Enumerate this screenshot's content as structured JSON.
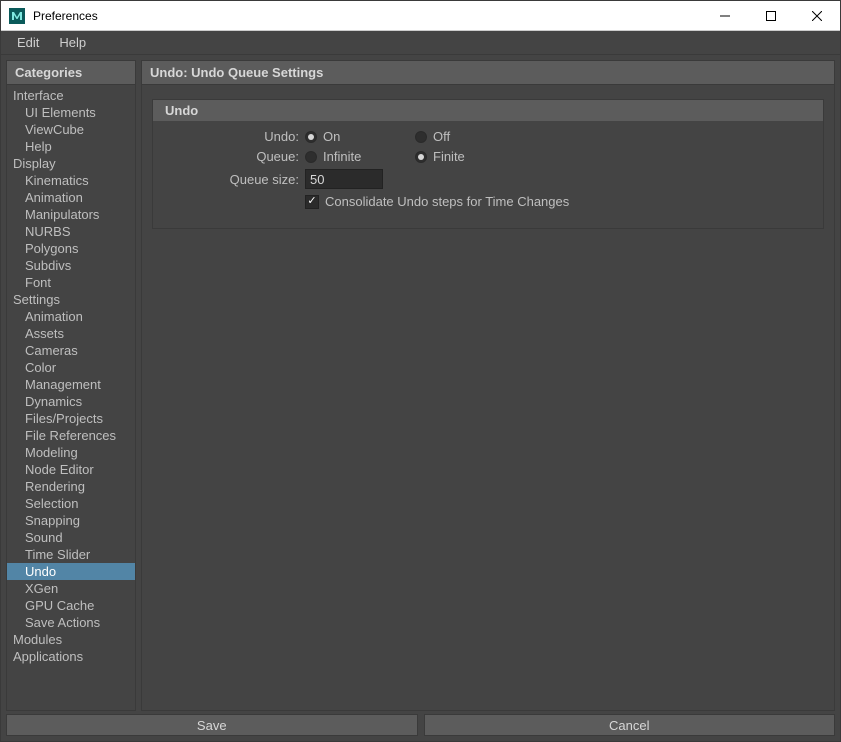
{
  "window": {
    "title": "Preferences"
  },
  "menubar": {
    "edit": "Edit",
    "help": "Help"
  },
  "sidebar": {
    "header": "Categories",
    "tree": [
      {
        "label": "Interface",
        "type": "group"
      },
      {
        "label": "UI Elements",
        "type": "item"
      },
      {
        "label": "ViewCube",
        "type": "item"
      },
      {
        "label": "Help",
        "type": "item"
      },
      {
        "label": "Display",
        "type": "group"
      },
      {
        "label": "Kinematics",
        "type": "item"
      },
      {
        "label": "Animation",
        "type": "item"
      },
      {
        "label": "Manipulators",
        "type": "item"
      },
      {
        "label": "NURBS",
        "type": "item"
      },
      {
        "label": "Polygons",
        "type": "item"
      },
      {
        "label": "Subdivs",
        "type": "item"
      },
      {
        "label": "Font",
        "type": "item"
      },
      {
        "label": "Settings",
        "type": "group"
      },
      {
        "label": "Animation",
        "type": "item"
      },
      {
        "label": "Assets",
        "type": "item"
      },
      {
        "label": "Cameras",
        "type": "item"
      },
      {
        "label": "Color Management",
        "type": "item"
      },
      {
        "label": "Dynamics",
        "type": "item"
      },
      {
        "label": "Files/Projects",
        "type": "item"
      },
      {
        "label": "File References",
        "type": "item"
      },
      {
        "label": "Modeling",
        "type": "item"
      },
      {
        "label": "Node Editor",
        "type": "item"
      },
      {
        "label": "Rendering",
        "type": "item"
      },
      {
        "label": "Selection",
        "type": "item"
      },
      {
        "label": "Snapping",
        "type": "item"
      },
      {
        "label": "Sound",
        "type": "item"
      },
      {
        "label": "Time Slider",
        "type": "item"
      },
      {
        "label": "Undo",
        "type": "item",
        "selected": true
      },
      {
        "label": "XGen",
        "type": "item"
      },
      {
        "label": "GPU Cache",
        "type": "item"
      },
      {
        "label": "Save Actions",
        "type": "item"
      },
      {
        "label": "Modules",
        "type": "group"
      },
      {
        "label": "Applications",
        "type": "group"
      }
    ]
  },
  "main": {
    "header": "Undo: Undo Queue Settings",
    "section_title": "Undo",
    "undo_label": "Undo:",
    "undo_on": "On",
    "undo_off": "Off",
    "undo_value": "On",
    "queue_label": "Queue:",
    "queue_infinite": "Infinite",
    "queue_finite": "Finite",
    "queue_value": "Finite",
    "queue_size_label": "Queue size:",
    "queue_size_value": "50",
    "consolidate_label": "Consolidate Undo steps for Time Changes",
    "consolidate_checked": true
  },
  "footer": {
    "save": "Save",
    "cancel": "Cancel"
  }
}
